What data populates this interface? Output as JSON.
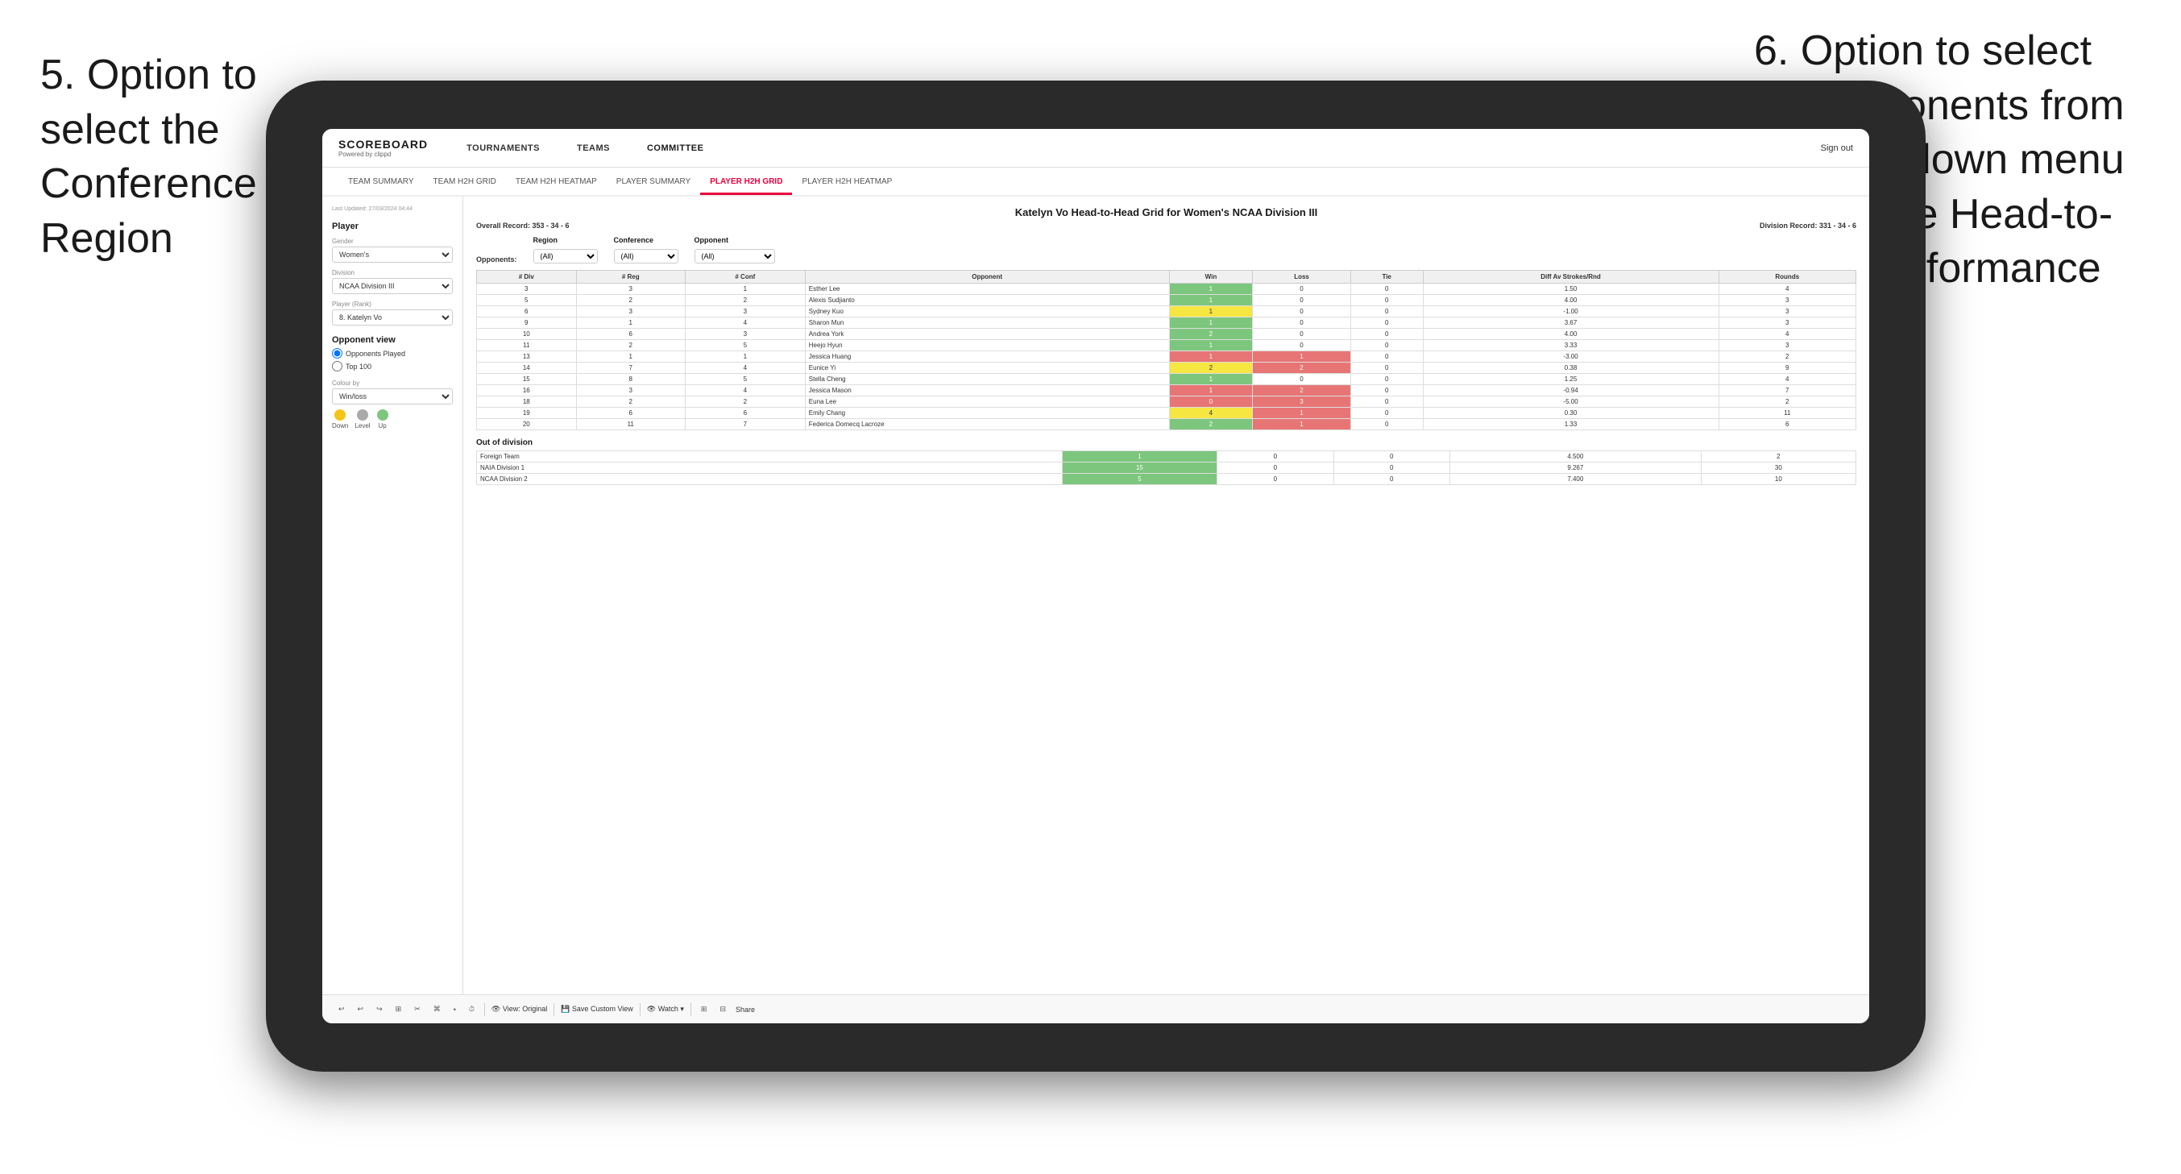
{
  "annotations": {
    "left_title": "5. Option to select the Conference and Region",
    "right_title": "6. Option to select the Opponents from the dropdown menu to see the Head-to-Head performance"
  },
  "nav": {
    "logo": "SCOREBOARD",
    "logo_sub": "Powered by clippd",
    "items": [
      "TOURNAMENTS",
      "TEAMS",
      "COMMITTEE"
    ],
    "sign_out": "Sign out"
  },
  "sub_nav": {
    "items": [
      "TEAM SUMMARY",
      "TEAM H2H GRID",
      "TEAM H2H HEATMAP",
      "PLAYER SUMMARY",
      "PLAYER H2H GRID",
      "PLAYER H2H HEATMAP"
    ],
    "active": "PLAYER H2H GRID"
  },
  "sidebar": {
    "last_updated": "Last Updated: 27/03/2024 04:44",
    "player_section": "Player",
    "gender_label": "Gender",
    "gender_value": "Women's",
    "division_label": "Division",
    "division_value": "NCAA Division III",
    "player_rank_label": "Player (Rank)",
    "player_rank_value": "8. Katelyn Vo",
    "opponent_view_label": "Opponent view",
    "opponent_options": [
      "Opponents Played",
      "Top 100"
    ],
    "colour_by_label": "Colour by",
    "colour_by_value": "Win/loss",
    "colors": [
      {
        "label": "Down",
        "color": "#f5c518"
      },
      {
        "label": "Level",
        "color": "#aaaaaa"
      },
      {
        "label": "Up",
        "color": "#7dc67d"
      }
    ]
  },
  "content": {
    "title": "Katelyn Vo Head-to-Head Grid for Women's NCAA Division III",
    "overall_record_label": "Overall Record:",
    "overall_record": "353 - 34 - 6",
    "division_record_label": "Division Record:",
    "division_record": "331 - 34 - 6",
    "filter_sections": {
      "region_label": "Region",
      "conference_label": "Conference",
      "opponent_label": "Opponent",
      "opponents_filter_label": "Opponents:",
      "region_value": "(All)",
      "conference_value": "(All)",
      "opponent_value": "(All)"
    },
    "table_headers": [
      "# Div",
      "# Reg",
      "# Conf",
      "Opponent",
      "Win",
      "Loss",
      "Tie",
      "Diff Av Strokes/Rnd",
      "Rounds"
    ],
    "rows": [
      {
        "div": 3,
        "reg": 3,
        "conf": 1,
        "opponent": "Esther Lee",
        "win": 1,
        "loss": 0,
        "tie": 0,
        "diff": 1.5,
        "rounds": 4,
        "win_color": "green"
      },
      {
        "div": 5,
        "reg": 2,
        "conf": 2,
        "opponent": "Alexis Sudjianto",
        "win": 1,
        "loss": 0,
        "tie": 0,
        "diff": 4.0,
        "rounds": 3,
        "win_color": "green"
      },
      {
        "div": 6,
        "reg": 3,
        "conf": 3,
        "opponent": "Sydney Kuo",
        "win": 1,
        "loss": 0,
        "tie": 0,
        "diff": -1.0,
        "rounds": 3,
        "win_color": "yellow"
      },
      {
        "div": 9,
        "reg": 1,
        "conf": 4,
        "opponent": "Sharon Mun",
        "win": 1,
        "loss": 0,
        "tie": 0,
        "diff": 3.67,
        "rounds": 3,
        "win_color": "green"
      },
      {
        "div": 10,
        "reg": 6,
        "conf": 3,
        "opponent": "Andrea York",
        "win": 2,
        "loss": 0,
        "tie": 0,
        "diff": 4.0,
        "rounds": 4,
        "win_color": "green"
      },
      {
        "div": 11,
        "reg": 2,
        "conf": 5,
        "opponent": "Heejo Hyun",
        "win": 1,
        "loss": 0,
        "tie": 0,
        "diff": 3.33,
        "rounds": 3,
        "win_color": "green"
      },
      {
        "div": 13,
        "reg": 1,
        "conf": 1,
        "opponent": "Jessica Huang",
        "win": 1,
        "loss": 1,
        "tie": 0,
        "diff": -3.0,
        "rounds": 2,
        "win_color": "red"
      },
      {
        "div": 14,
        "reg": 7,
        "conf": 4,
        "opponent": "Eunice Yi",
        "win": 2,
        "loss": 2,
        "tie": 0,
        "diff": 0.38,
        "rounds": 9,
        "win_color": "yellow"
      },
      {
        "div": 15,
        "reg": 8,
        "conf": 5,
        "opponent": "Stella Cheng",
        "win": 1,
        "loss": 0,
        "tie": 0,
        "diff": 1.25,
        "rounds": 4,
        "win_color": "green"
      },
      {
        "div": 16,
        "reg": 3,
        "conf": 4,
        "opponent": "Jessica Mason",
        "win": 1,
        "loss": 2,
        "tie": 0,
        "diff": -0.94,
        "rounds": 7,
        "win_color": "red"
      },
      {
        "div": 18,
        "reg": 2,
        "conf": 2,
        "opponent": "Euna Lee",
        "win": 0,
        "loss": 3,
        "tie": 0,
        "diff": -5.0,
        "rounds": 2,
        "win_color": "red"
      },
      {
        "div": 19,
        "reg": 6,
        "conf": 6,
        "opponent": "Emily Chang",
        "win": 4,
        "loss": 1,
        "tie": 0,
        "diff": 0.3,
        "rounds": 11,
        "win_color": "yellow"
      },
      {
        "div": 20,
        "reg": 11,
        "conf": 7,
        "opponent": "Federica Domecq Lacroze",
        "win": 2,
        "loss": 1,
        "tie": 0,
        "diff": 1.33,
        "rounds": 6,
        "win_color": "green"
      }
    ],
    "out_of_division": {
      "label": "Out of division",
      "rows": [
        {
          "label": "Foreign Team",
          "win": 1,
          "loss": 0,
          "tie": 0,
          "diff": 4.5,
          "rounds": 2
        },
        {
          "label": "NAIA Division 1",
          "win": 15,
          "loss": 0,
          "tie": 0,
          "diff": 9.267,
          "rounds": 30
        },
        {
          "label": "NCAA Division 2",
          "win": 5,
          "loss": 0,
          "tie": 0,
          "diff": 7.4,
          "rounds": 10
        }
      ]
    }
  },
  "toolbar": {
    "buttons": [
      "↩",
      "↩",
      "↪",
      "⊞",
      "✂",
      "⌘",
      "•",
      "⏱",
      "|",
      "View: Original",
      "|",
      "Save Custom View",
      "|",
      "Watch ▾",
      "|",
      "⊞",
      "⊟",
      "Share"
    ]
  }
}
